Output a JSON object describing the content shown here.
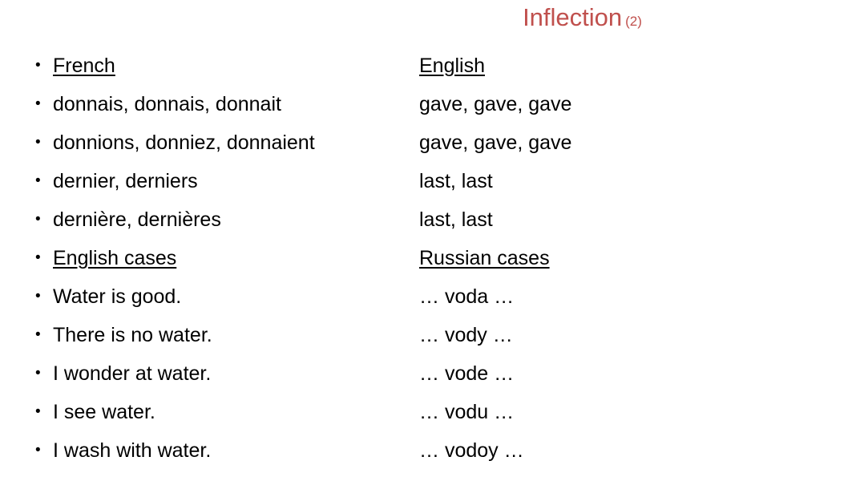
{
  "slide": {
    "background_color": "#ffffff",
    "text_color": "#000000"
  },
  "title": {
    "main": "Inflection",
    "suffix": "(2)",
    "color": "#C0504D"
  },
  "columns": {
    "left": {
      "name": "French / English examples",
      "bulleted": true,
      "rows": [
        {
          "text": "French",
          "underlined": true
        },
        {
          "text": "donnais, donnais, donnait",
          "underlined": false
        },
        {
          "text": "donnions, donniez, donnaient",
          "underlined": false
        },
        {
          "text": "dernier, derniers",
          "underlined": false
        },
        {
          "text": "dernière, dernières",
          "underlined": false
        },
        {
          "text": "English cases",
          "underlined": true
        },
        {
          "text": "Water is good.",
          "underlined": false
        },
        {
          "text": "There is no water.",
          "underlined": false
        },
        {
          "text": "I wonder at water.",
          "underlined": false
        },
        {
          "text": "I see water.",
          "underlined": false
        },
        {
          "text": "I wash with water.",
          "underlined": false
        }
      ]
    },
    "right": {
      "name": "English / Russian glosses",
      "bulleted": false,
      "rows": [
        {
          "text": "English",
          "underlined": true
        },
        {
          "text": "gave, gave, gave",
          "underlined": false
        },
        {
          "text": "gave, gave, gave",
          "underlined": false
        },
        {
          "text": "last, last",
          "underlined": false
        },
        {
          "text": "last, last",
          "underlined": false
        },
        {
          "text": "Russian cases",
          "underlined": true
        },
        {
          "text": "… voda …",
          "underlined": false
        },
        {
          "text": "… vody …",
          "underlined": false
        },
        {
          "text": "… vode …",
          "underlined": false
        },
        {
          "text": "… vodu …",
          "underlined": false
        },
        {
          "text": "… vodoy …",
          "underlined": false
        }
      ]
    }
  }
}
